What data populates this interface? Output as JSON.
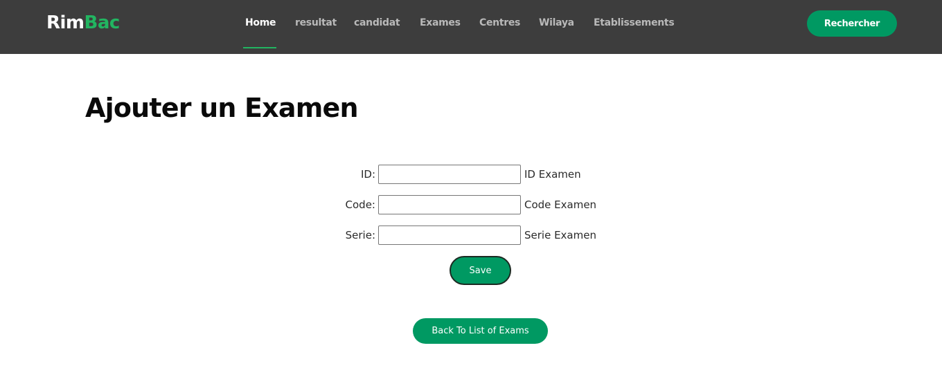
{
  "brand": {
    "part1": "Rim",
    "part2": "Bac",
    "accent_color": "#22b561"
  },
  "nav": {
    "items": [
      {
        "label": "Home",
        "active": true
      },
      {
        "label": "resultat"
      },
      {
        "label": "candidat"
      },
      {
        "label": "Exames"
      },
      {
        "label": "Centres"
      },
      {
        "label": "Wilaya"
      },
      {
        "label": "Etablissements"
      }
    ],
    "search_button": "Rechercher"
  },
  "page": {
    "title": "Ajouter un Examen"
  },
  "form": {
    "fields": [
      {
        "label": "ID:",
        "value": "",
        "hint": "ID Examen"
      },
      {
        "label": "Code:",
        "value": "",
        "hint": "Code Examen"
      },
      {
        "label": "Serie:",
        "value": "",
        "hint": "Serie Examen"
      }
    ],
    "save_button": "Save"
  },
  "back_button": "Back To List of Exams",
  "colors": {
    "navbar": "#3d3d3d",
    "primary": "#009962"
  }
}
